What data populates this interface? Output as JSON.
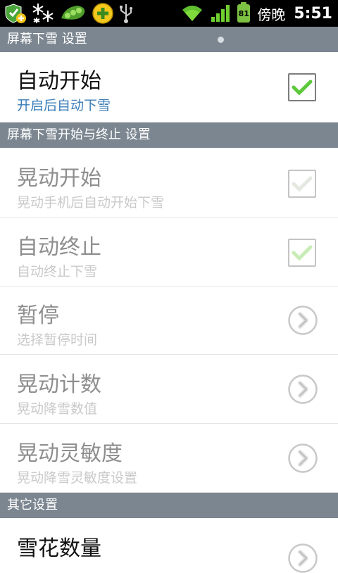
{
  "status_bar": {
    "carrier": "傍晚",
    "time": "5:51",
    "battery_level": "81",
    "icons": [
      "shield-plus-icon",
      "snowflakes-icon",
      "peas-icon",
      "add-coin-icon",
      "usb-icon",
      "wifi-icon",
      "signal-icon",
      "battery-icon"
    ]
  },
  "sections": [
    {
      "header": "屏幕下雪 设置",
      "rows": [
        {
          "title": "自动开始",
          "subtitle": "开启后自动下雪",
          "control": "checkbox",
          "checked": true,
          "enabled": true
        }
      ]
    },
    {
      "header": "屏幕下雪开始与终止 设置",
      "rows": [
        {
          "title": "晃动开始",
          "subtitle": "晃动手机后自动开始下雪",
          "control": "checkbox",
          "checked": true,
          "enabled": false
        },
        {
          "title": "自动终止",
          "subtitle": "自动终止下雪",
          "control": "checkbox",
          "checked": true,
          "enabled": false
        },
        {
          "title": "暂停",
          "subtitle": "选择暂停时间",
          "control": "chevron",
          "enabled": false
        },
        {
          "title": "晃动计数",
          "subtitle": "晃动降雪数值",
          "control": "chevron",
          "enabled": false
        },
        {
          "title": "晃动灵敏度",
          "subtitle": "晃动降雪灵敏度设置",
          "control": "chevron",
          "enabled": false
        }
      ]
    },
    {
      "header": "其它设置",
      "rows": [
        {
          "title": "雪花数量",
          "control": "chevron",
          "enabled": true
        }
      ]
    }
  ],
  "colors": {
    "status_bar_bg": "#000000",
    "section_header_bg": "#7b8690",
    "subtitle_blue": "#3a7db7",
    "check_green": "#5cc83a"
  }
}
